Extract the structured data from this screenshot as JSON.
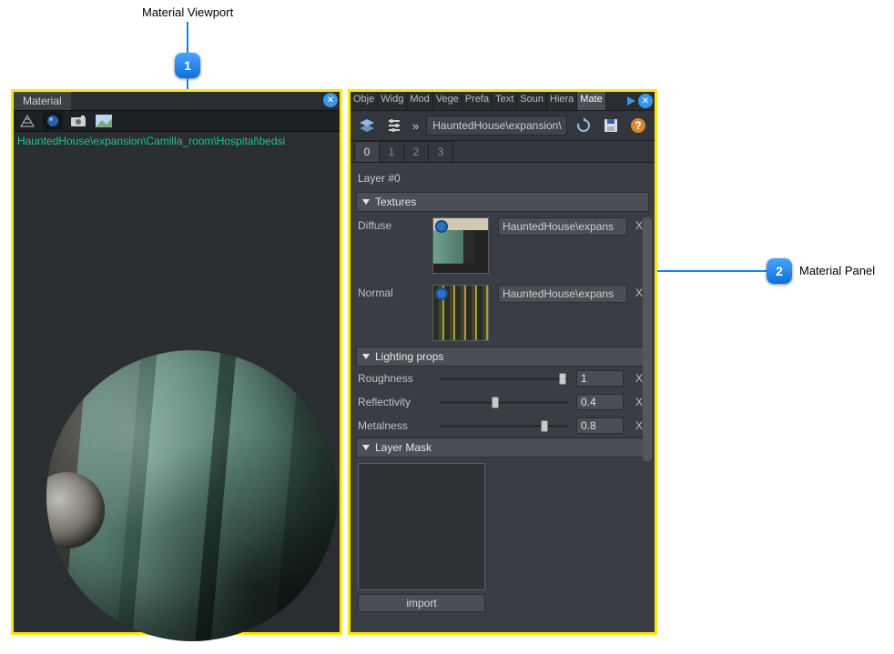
{
  "callouts": {
    "viewport_label": "Material Viewport",
    "viewport_num": "1",
    "panel_label": "Material Panel",
    "panel_num": "2"
  },
  "viewport": {
    "tab_title": "Material",
    "asset_path": "HauntedHouse\\expansion\\Camilla_room\\Hospital\\bedsi"
  },
  "panel": {
    "top_tabs": [
      "Obje",
      "Widg",
      "Mod",
      "Vege",
      "Prefa",
      "Text",
      "Soun",
      "Hiera",
      "Mate"
    ],
    "top_tabs_active": "Mate",
    "toolbar_path": "HauntedHouse\\expansion\\",
    "sub_tabs": [
      "0",
      "1",
      "2",
      "3"
    ],
    "sub_tabs_active": "0",
    "layer_label": "Layer #0",
    "sections": {
      "textures": {
        "title": "Textures",
        "rows": [
          {
            "label": "Diffuse",
            "path": "HauntedHouse\\expans",
            "clear": "X"
          },
          {
            "label": "Normal",
            "path": "HauntedHouse\\expans",
            "clear": "X"
          }
        ]
      },
      "lighting": {
        "title": "Lighting props",
        "rows": [
          {
            "label": "Roughness",
            "value": "1",
            "pos": 0.92,
            "clear": "X"
          },
          {
            "label": "Reflectivity",
            "value": "0.4",
            "pos": 0.4,
            "clear": "X"
          },
          {
            "label": "Metalness",
            "value": "0.8",
            "pos": 0.78,
            "clear": "X"
          }
        ]
      },
      "mask": {
        "title": "Layer Mask",
        "import_label": "import"
      }
    }
  }
}
